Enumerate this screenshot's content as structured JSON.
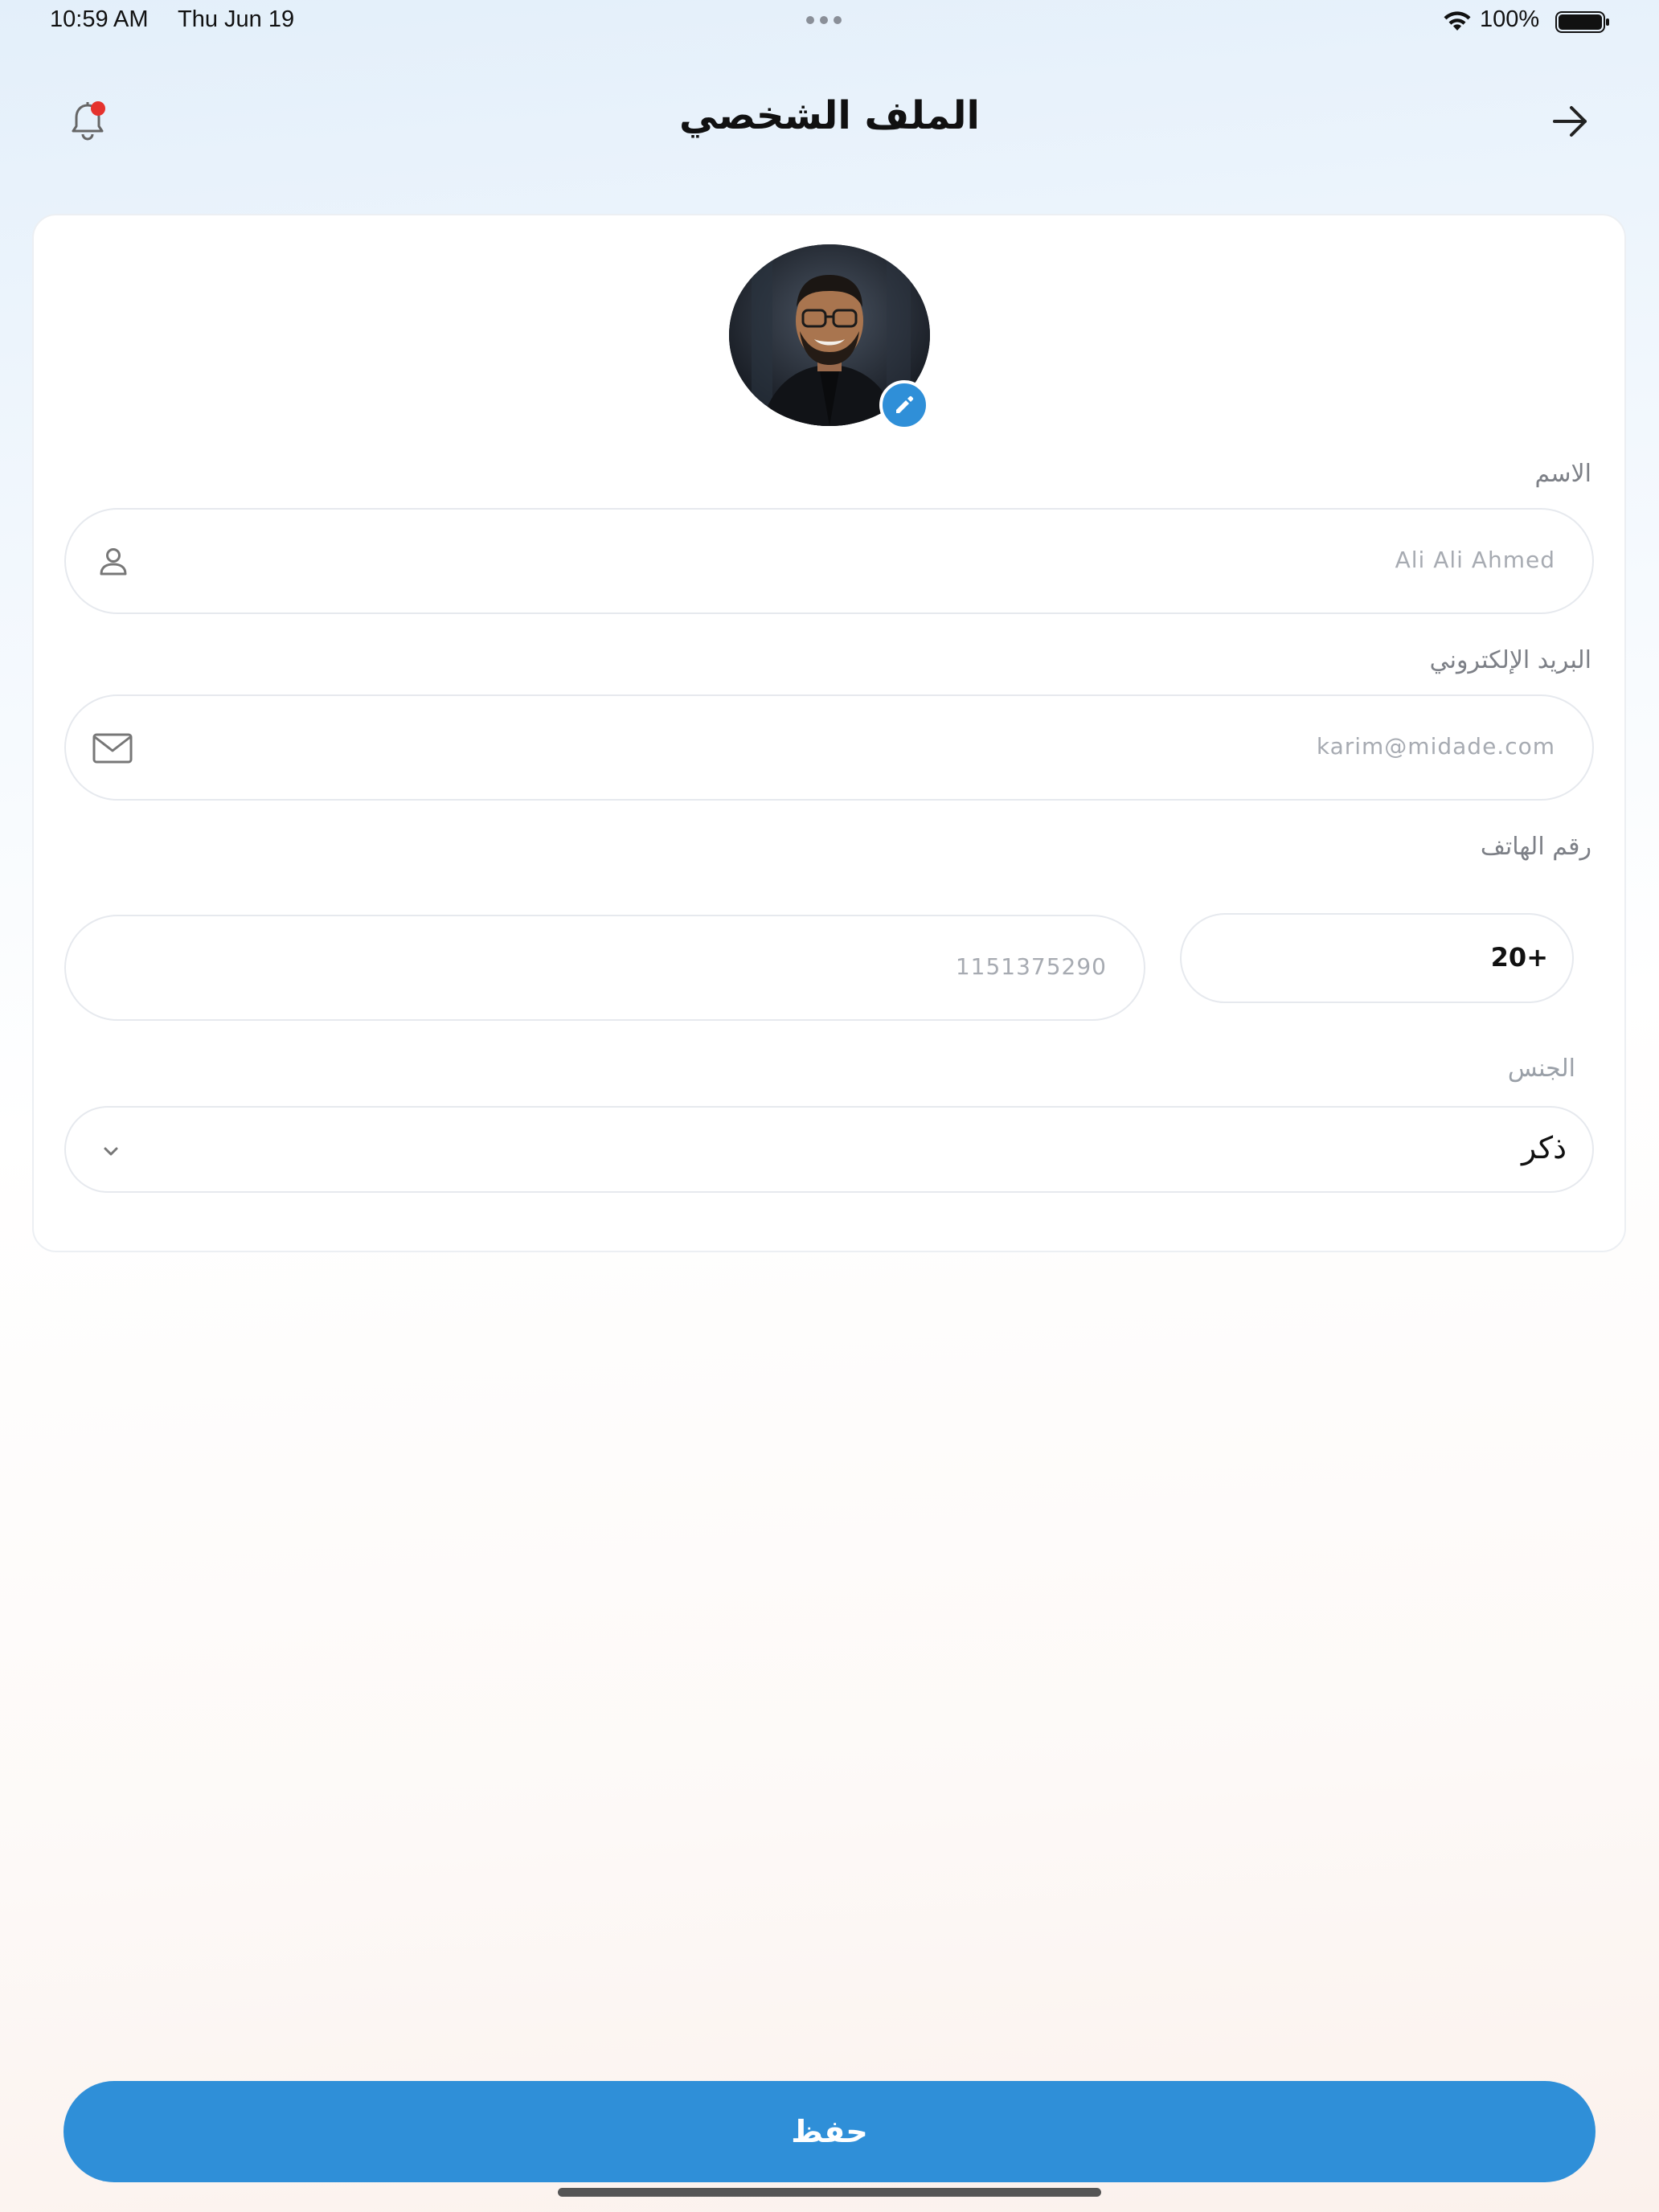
{
  "status_bar": {
    "time": "10:59 AM",
    "date": "Thu Jun 19",
    "battery": "100%",
    "battery_level": 1.0
  },
  "header": {
    "title": "الملف الشخصي",
    "notification_icon": "bell-icon",
    "back_icon": "arrow-right-icon",
    "has_unread_notification": true
  },
  "profile": {
    "avatar_icon": "avatar",
    "edit_icon": "pencil-icon"
  },
  "form": {
    "name": {
      "label": "الاسم",
      "value": "Ali Ali Ahmed",
      "icon": "user-icon"
    },
    "email": {
      "label": "البريد الإلكتروني",
      "value": "karim@midade.com",
      "icon": "mail-icon"
    },
    "phone": {
      "label": "رقم الهاتف",
      "value": "1151375290",
      "country_code": "20+"
    },
    "gender": {
      "label": "الجنس",
      "value": "ذكر",
      "icon": "chevron-down-icon"
    }
  },
  "actions": {
    "save_label": "حفظ"
  },
  "colors": {
    "accent": "#2f8fd8",
    "notification_dot": "#e5322d",
    "text": "#111111",
    "muted": "#a7abb2"
  }
}
